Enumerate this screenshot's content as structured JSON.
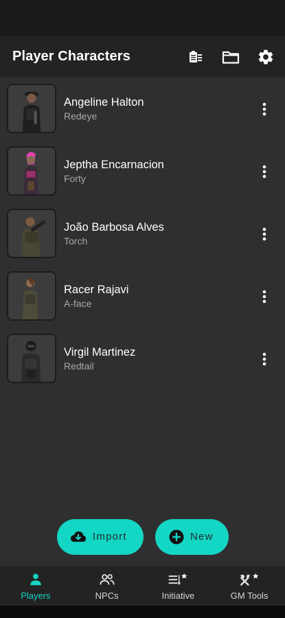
{
  "appbar": {
    "title": "Player Characters",
    "actions": [
      {
        "name": "clipboard-list-icon"
      },
      {
        "name": "folder-icon"
      },
      {
        "name": "gear-icon"
      }
    ]
  },
  "characters": [
    {
      "name": "Angeline Halton",
      "callsign": "Redeye",
      "portrait": "character-portrait-icon"
    },
    {
      "name": "Jeptha Encarnacion",
      "callsign": "Forty",
      "portrait": "character-portrait-icon"
    },
    {
      "name": "João Barbosa Alves",
      "callsign": "Torch",
      "portrait": "character-portrait-icon"
    },
    {
      "name": "Racer Rajavi",
      "callsign": "A-face",
      "portrait": "character-portrait-icon"
    },
    {
      "name": "Virgil Martinez",
      "callsign": "Redtail",
      "portrait": "character-portrait-icon"
    }
  ],
  "fabs": {
    "import_label": "Import",
    "new_label": "New"
  },
  "bottom_nav": [
    {
      "label": "Players",
      "icon": "person-icon",
      "active": true
    },
    {
      "label": "NPCs",
      "icon": "people-icon",
      "active": false
    },
    {
      "label": "Initiative",
      "icon": "list-star-icon",
      "active": false
    },
    {
      "label": "GM Tools",
      "icon": "tools-star-icon",
      "active": false
    }
  ],
  "colors": {
    "accent": "#14d6c4",
    "background": "#2f2f2f",
    "appbar": "#232323",
    "text_primary": "#ffffff",
    "text_secondary": "#a8a8a8"
  }
}
